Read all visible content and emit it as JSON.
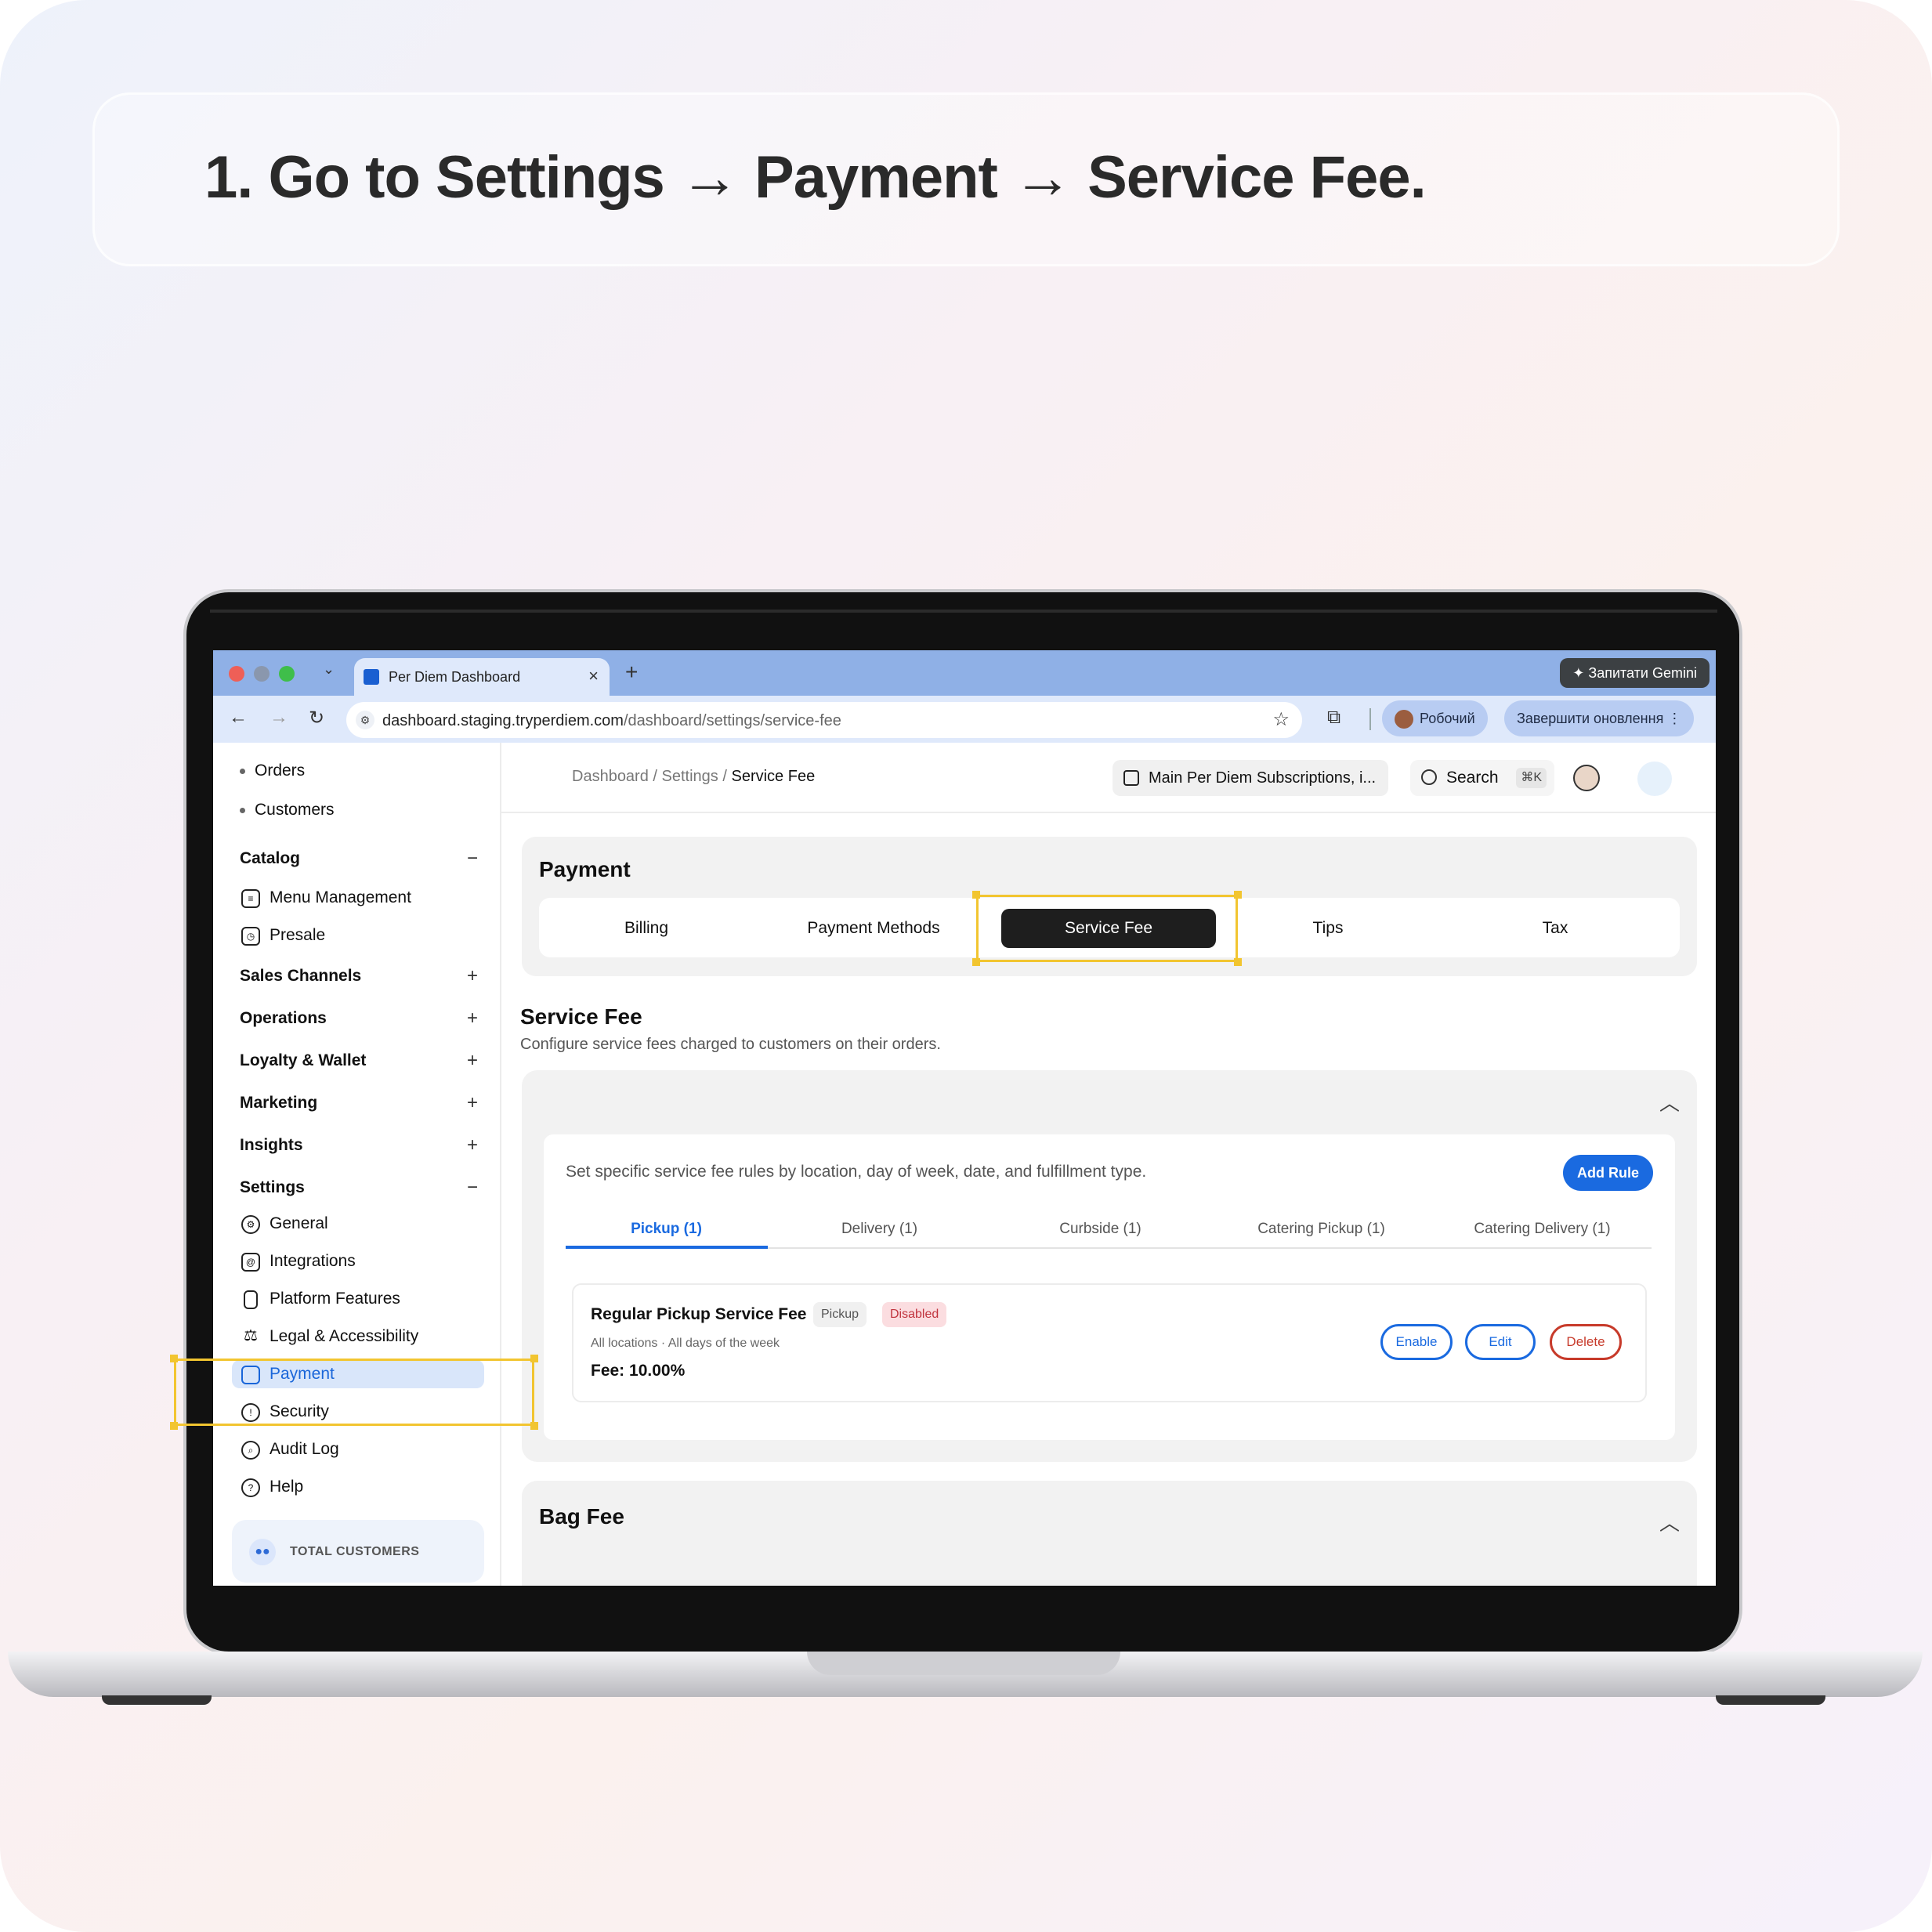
{
  "instruction": {
    "title": "1. Go to Settings → Payment → Service Fee."
  },
  "browser": {
    "tab_title": "Per Diem Dashboard",
    "tab_close": "×",
    "new_tab": "+",
    "gemini_label": "✦ Запитати Gemini",
    "url_host": "dashboard.staging.tryperdiem.com",
    "url_path": "/dashboard/settings/service-fee",
    "profile_label": "Робочий",
    "update_label": "Завершити оновлення ⋮",
    "back": "←",
    "forward": "→",
    "reload": "↻",
    "star": "☆",
    "extensions": "⧉"
  },
  "sidebar": {
    "items_top": [
      {
        "label": "Orders"
      },
      {
        "label": "Customers"
      }
    ],
    "sections": [
      {
        "label": "Catalog",
        "toggle": "−"
      },
      {
        "label": "Sales Channels",
        "toggle": "+"
      },
      {
        "label": "Operations",
        "toggle": "+"
      },
      {
        "label": "Loyalty & Wallet",
        "toggle": "+"
      },
      {
        "label": "Marketing",
        "toggle": "+"
      },
      {
        "label": "Insights",
        "toggle": "+"
      },
      {
        "label": "Settings",
        "toggle": "−"
      }
    ],
    "catalog_items": [
      {
        "label": "Menu Management"
      },
      {
        "label": "Presale"
      }
    ],
    "settings_items": [
      {
        "label": "General"
      },
      {
        "label": "Integrations"
      },
      {
        "label": "Platform Features"
      },
      {
        "label": "Legal & Accessibility"
      },
      {
        "label": "Payment",
        "active": true
      },
      {
        "label": "Security"
      },
      {
        "label": "Audit Log"
      },
      {
        "label": "Help"
      }
    ],
    "total_customers_label": "TOTAL CUSTOMERS"
  },
  "header": {
    "breadcrumb": {
      "root": "Dashboard",
      "mid": "Settings",
      "current": "Service Fee",
      "sep": "/"
    },
    "store_label": "Main Per Diem Subscriptions, i...",
    "search_label": "Search",
    "search_shortcut": "⌘K"
  },
  "payment": {
    "title": "Payment",
    "tabs": [
      {
        "label": "Billing"
      },
      {
        "label": "Payment Methods"
      },
      {
        "label": "Service Fee",
        "active": true
      },
      {
        "label": "Tips"
      },
      {
        "label": "Tax"
      }
    ]
  },
  "service_fee": {
    "title": "Service Fee",
    "description": "Configure service fees charged to customers on their orders.",
    "rules_description": "Set specific service fee rules by location, day of week, date, and fulfillment type.",
    "add_rule_label": "Add Rule",
    "collapse_icon": "︿",
    "fulfillment_tabs": [
      {
        "label": "Pickup (1)",
        "active": true
      },
      {
        "label": "Delivery (1)"
      },
      {
        "label": "Curbside (1)"
      },
      {
        "label": "Catering Pickup (1)"
      },
      {
        "label": "Catering Delivery (1)"
      }
    ],
    "rule": {
      "name": "Regular Pickup Service Fee",
      "type_badge": "Pickup",
      "status_badge": "Disabled",
      "meta": "All locations · All days of the week",
      "fee": "Fee: 10.00%",
      "enable_label": "Enable",
      "edit_label": "Edit",
      "delete_label": "Delete"
    }
  },
  "bag_fee": {
    "title": "Bag Fee",
    "collapse_icon": "︿"
  },
  "colors": {
    "accent": "#1a6ae0",
    "highlight": "#f2c530",
    "danger": "#c73a2a"
  }
}
